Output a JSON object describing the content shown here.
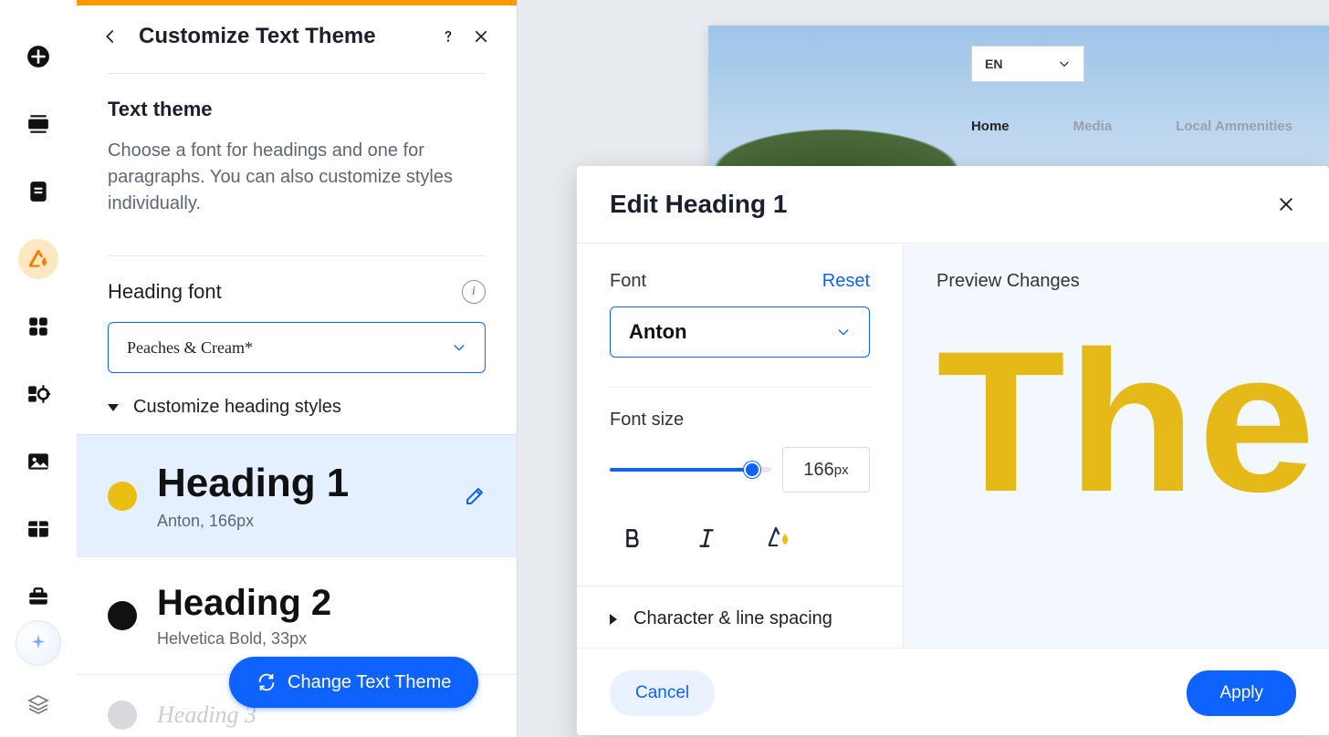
{
  "panel": {
    "title": "Customize Text Theme",
    "section_title": "Text theme",
    "description": "Choose a font for headings and one for paragraphs. You can also customize styles individually.",
    "heading_font_label": "Heading font",
    "heading_font_value": "Peaches & Cream*",
    "collapse_label": "Customize heading styles",
    "headings": [
      {
        "title": "Heading 1",
        "meta": "Anton, 166px"
      },
      {
        "title": "Heading 2",
        "meta": "Helvetica Bold, 33px"
      },
      {
        "title": "Heading 3",
        "meta": ""
      }
    ],
    "change_button": "Change Text Theme"
  },
  "canvas": {
    "lang": "EN",
    "nav": {
      "home": "Home",
      "media": "Media",
      "amenities": "Local Ammenities"
    }
  },
  "modal": {
    "title": "Edit Heading 1",
    "font_label": "Font",
    "reset": "Reset",
    "font_value": "Anton",
    "font_size_label": "Font size",
    "font_size_value": "166",
    "font_size_unit": "px",
    "spacing_label": "Character & line spacing",
    "preview_label": "Preview Changes",
    "preview_text": "The",
    "cancel": "Cancel",
    "apply": "Apply"
  }
}
